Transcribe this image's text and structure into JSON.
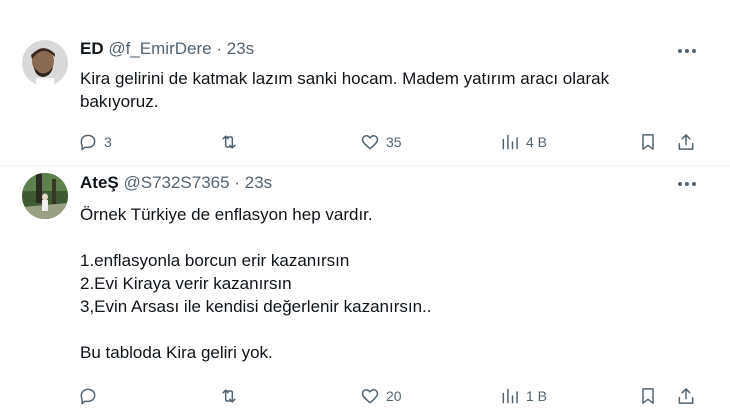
{
  "tweets": [
    {
      "display_name": "ED",
      "handle": "@f_EmirDere",
      "separator": "·",
      "time": "23s",
      "lines": [
        "Kira gelirini de katmak lazım sanki hocam. Madem yatırım aracı olarak",
        "bakıyoruz."
      ],
      "replies": "3",
      "retweets": "",
      "likes": "35",
      "views": "4 B"
    },
    {
      "display_name": "AteŞ",
      "handle": "@S732S7365",
      "separator": "·",
      "time": "23s",
      "lines": [
        "Örnek Türkiye de enflasyon hep vardır.",
        "",
        "1.enflasyonla  borcun erir kazanırsın",
        "2.Evi Kiraya verir kazanırsın",
        "3,Evin Arsası ile  kendisi değerlenir kazanırsın..",
        "",
        "Bu tabloda Kira geliri yok."
      ],
      "replies": "",
      "retweets": "",
      "likes": "20",
      "views": "1 B"
    }
  ],
  "icons": [
    "reply-icon",
    "retweet-icon",
    "like-icon",
    "views-icon",
    "bookmark-icon",
    "share-icon",
    "more-icon"
  ],
  "colors": {
    "text": "#0f1419",
    "secondary": "#536471",
    "divider": "#eff3f4"
  }
}
